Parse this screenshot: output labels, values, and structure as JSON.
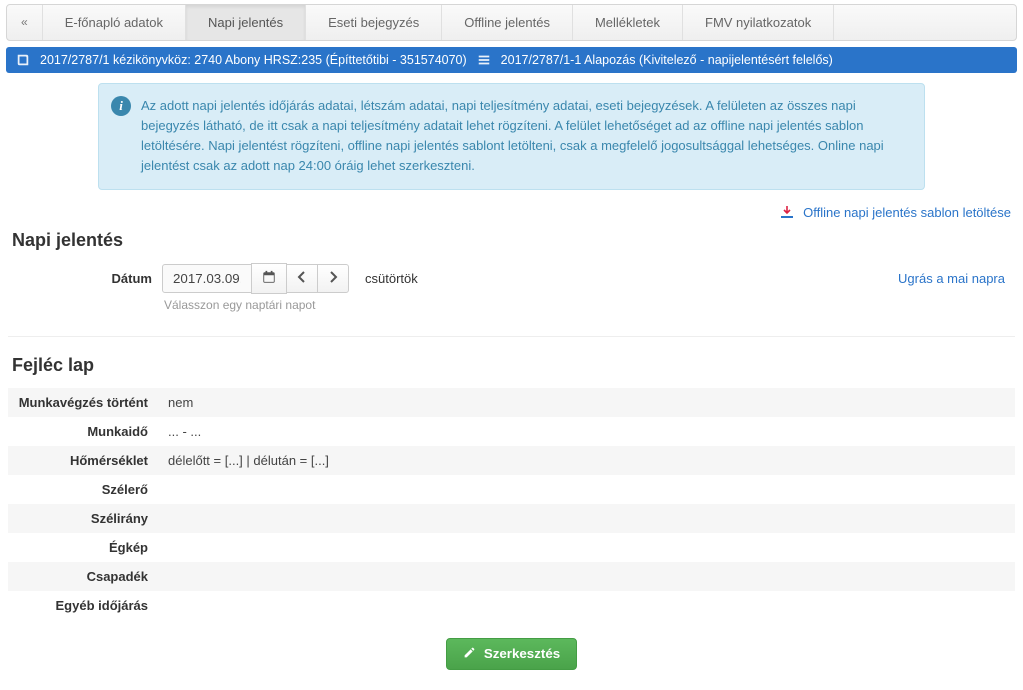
{
  "tabs": {
    "collapse_glyph": "«",
    "items": [
      {
        "label": "E-főnapló adatok"
      },
      {
        "label": "Napi jelentés",
        "active": true
      },
      {
        "label": "Eseti bejegyzés"
      },
      {
        "label": "Offline jelentés"
      },
      {
        "label": "Mellékletek"
      },
      {
        "label": "FMV nyilatkozatok"
      }
    ]
  },
  "bluebar": {
    "left": "2017/2787/1 kézikönyvköz: 2740 Abony HRSZ:235 (Építtetőtibi - 351574070)",
    "right": "2017/2787/1-1 Alapozás (Kivitelező - napijelentésért felelős)"
  },
  "info_text": "Az adott napi jelentés időjárás adatai, létszám adatai, napi teljesítmény adatai, eseti bejegyzések. A felületen az összes napi bejegyzés látható, de itt csak a napi teljesítmény adatait lehet rögzíteni. A felület lehetőséget ad az offline napi jelentés sablon letöltésére. Napi jelentést rögzíteni, offline napi jelentés sablont letölteni, csak a megfelelő jogosultsággal lehetséges. Online napi jelentést csak az adott nap 24:00 óráig lehet szerkeszteni.",
  "download_link": "Offline napi jelentés sablon letöltése",
  "section1_title": "Napi jelentés",
  "date": {
    "label": "Dátum",
    "value": "2017.03.09.",
    "dayname": "csütörtök",
    "hint": "Válasszon egy naptári napot",
    "today_link": "Ugrás a mai napra"
  },
  "section2_title": "Fejléc lap",
  "header_rows": [
    {
      "k": "Munkavégzés történt",
      "v": "nem"
    },
    {
      "k": "Munkaidő",
      "v": "... - ..."
    },
    {
      "k": "Hőmérséklet",
      "v": "délelőtt = [...]    |    délután = [...]"
    },
    {
      "k": "Szélerő",
      "v": ""
    },
    {
      "k": "Szélirány",
      "v": ""
    },
    {
      "k": "Égkép",
      "v": ""
    },
    {
      "k": "Csapadék",
      "v": ""
    },
    {
      "k": "Egyéb időjárás",
      "v": ""
    }
  ],
  "edit_button": "Szerkesztés"
}
